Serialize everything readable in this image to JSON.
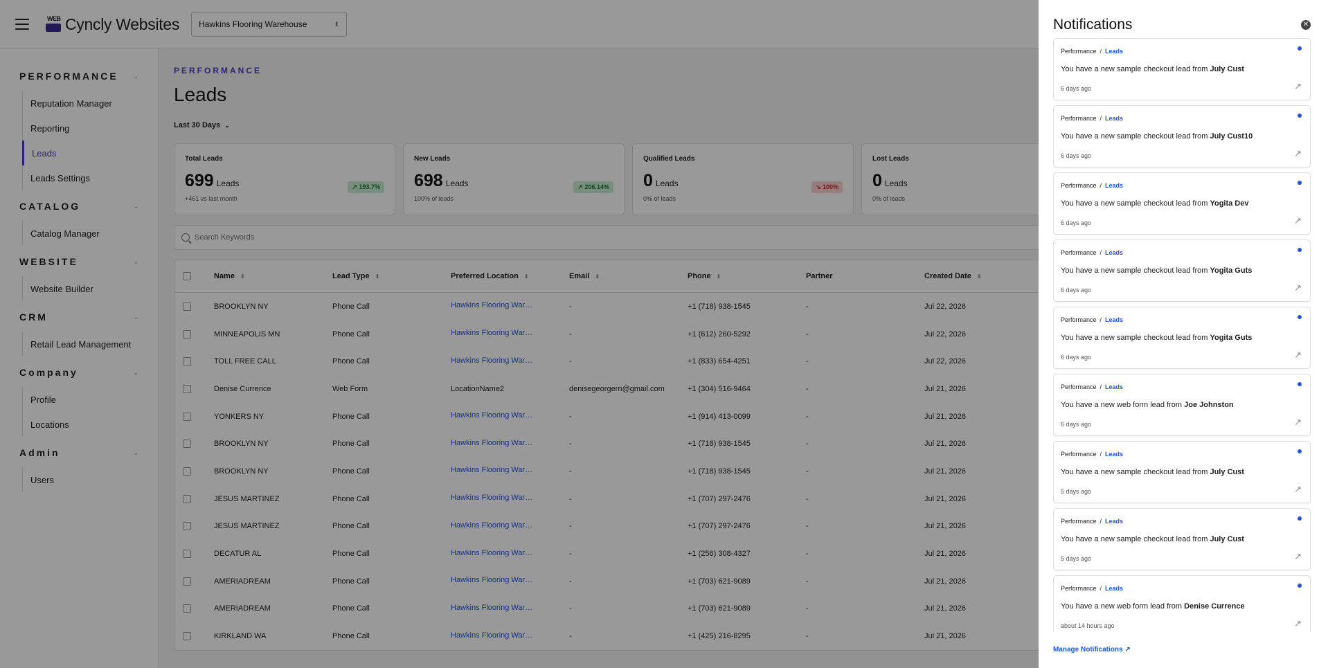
{
  "header": {
    "logo_text": "Cyncly Websites",
    "logo_mark_text": "WEB",
    "store_select": "Hawkins Flooring Warehouse"
  },
  "sidebar": {
    "sections": [
      {
        "title": "PERFORMANCE",
        "items": [
          "Reputation Manager",
          "Reporting",
          "Leads",
          "Leads Settings"
        ]
      },
      {
        "title": "CATALOG",
        "items": [
          "Catalog Manager"
        ]
      },
      {
        "title": "WEBSITE",
        "items": [
          "Website Builder"
        ]
      },
      {
        "title": "CRM",
        "items": [
          "Retail Lead Management"
        ]
      },
      {
        "title": "Company",
        "items": [
          "Profile",
          "Locations"
        ]
      },
      {
        "title": "Admin",
        "items": [
          "Users"
        ]
      }
    ],
    "active_item": "Leads"
  },
  "main": {
    "eyebrow": "PERFORMANCE",
    "title": "Leads",
    "range": "Last 30 Days",
    "search_placeholder": "Search Keywords",
    "cards": [
      {
        "label": "Total Leads",
        "value": "699",
        "unit": "Leads",
        "sub": "+461 vs last month",
        "badge": "↗ 193.7%",
        "trend": "up"
      },
      {
        "label": "New Leads",
        "value": "698",
        "unit": "Leads",
        "sub": "100% of leads",
        "badge": "↗ 206.14%",
        "trend": "up"
      },
      {
        "label": "Qualified Leads",
        "value": "0",
        "unit": "Leads",
        "sub": "0% of leads",
        "badge": "↘ 100%",
        "trend": "down"
      },
      {
        "label": "Lost Leads",
        "value": "0",
        "unit": "Leads",
        "sub": "0% of leads",
        "badge": "",
        "trend": ""
      }
    ],
    "columns": [
      "Name",
      "Lead Type",
      "Preferred Location",
      "Email",
      "Phone",
      "Partner",
      "Created Date"
    ],
    "rows": [
      [
        "BROOKLYN NY",
        "Phone Call",
        "Hawkins Flooring Ware...",
        "-",
        "+1 (718) 938-1545",
        "-",
        "Jul 22, 2026"
      ],
      [
        "MINNEAPOLIS MN",
        "Phone Call",
        "Hawkins Flooring Ware...",
        "-",
        "+1 (612) 260-5292",
        "-",
        "Jul 22, 2026"
      ],
      [
        "TOLL FREE CALL",
        "Phone Call",
        "Hawkins Flooring Ware...",
        "-",
        "+1 (833) 654-4251",
        "-",
        "Jul 22, 2026"
      ],
      [
        "Denise Currence",
        "Web Form",
        "LocationName2",
        "denisegeorgern@gmail.com",
        "+1 (304) 516-9464",
        "-",
        "Jul 21, 2026"
      ],
      [
        "YONKERS NY",
        "Phone Call",
        "Hawkins Flooring Ware...",
        "-",
        "+1 (914) 413-0099",
        "-",
        "Jul 21, 2026"
      ],
      [
        "BROOKLYN NY",
        "Phone Call",
        "Hawkins Flooring Ware...",
        "-",
        "+1 (718) 938-1545",
        "-",
        "Jul 21, 2026"
      ],
      [
        "BROOKLYN NY",
        "Phone Call",
        "Hawkins Flooring Ware...",
        "-",
        "+1 (718) 938-1545",
        "-",
        "Jul 21, 2026"
      ],
      [
        "JESUS MARTINEZ",
        "Phone Call",
        "Hawkins Flooring Ware...",
        "-",
        "+1 (707) 297-2476",
        "-",
        "Jul 21, 2026"
      ],
      [
        "JESUS MARTINEZ",
        "Phone Call",
        "Hawkins Flooring Ware...",
        "-",
        "+1 (707) 297-2476",
        "-",
        "Jul 21, 2026"
      ],
      [
        "DECATUR AL",
        "Phone Call",
        "Hawkins Flooring Ware...",
        "-",
        "+1 (256) 308-4327",
        "-",
        "Jul 21, 2026"
      ],
      [
        "AMERIADREAM",
        "Phone Call",
        "Hawkins Flooring Ware...",
        "-",
        "+1 (703) 621-9089",
        "-",
        "Jul 21, 2026"
      ],
      [
        "AMERIADREAM",
        "Phone Call",
        "Hawkins Flooring Ware...",
        "-",
        "+1 (703) 621-9089",
        "-",
        "Jul 21, 2026"
      ],
      [
        "KIRKLAND WA",
        "Phone Call",
        "Hawkins Flooring Ware...",
        "-",
        "+1 (425) 216-8295",
        "-",
        "Jul 21, 2026"
      ]
    ]
  },
  "notifications": {
    "title": "Notifications",
    "crumb_root": "Performance",
    "crumb_sep": "/",
    "crumb_leaf": "Leads",
    "items": [
      {
        "prefix": "You have a new sample checkout lead from ",
        "name": "July Cust",
        "time": "6 days ago"
      },
      {
        "prefix": "You have a new sample checkout lead from ",
        "name": "July Cust10",
        "time": "6 days ago"
      },
      {
        "prefix": "You have a new sample checkout lead from ",
        "name": "Yogita Dev",
        "time": "6 days ago"
      },
      {
        "prefix": "You have a new sample checkout lead from ",
        "name": "Yogita Guts",
        "time": "6 days ago"
      },
      {
        "prefix": "You have a new sample checkout lead from ",
        "name": "Yogita Guts",
        "time": "6 days ago"
      },
      {
        "prefix": "You have a new web form lead from ",
        "name": "Joe Johnston",
        "time": "6 days ago"
      },
      {
        "prefix": "You have a new sample checkout lead from ",
        "name": "July Cust",
        "time": "5 days ago"
      },
      {
        "prefix": "You have a new sample checkout lead from ",
        "name": "July Cust",
        "time": "5 days ago"
      },
      {
        "prefix": "You have a new web form lead from ",
        "name": "Denise Currence",
        "time": "about 14 hours ago"
      }
    ],
    "manage_label": "Manage Notifications ↗"
  }
}
